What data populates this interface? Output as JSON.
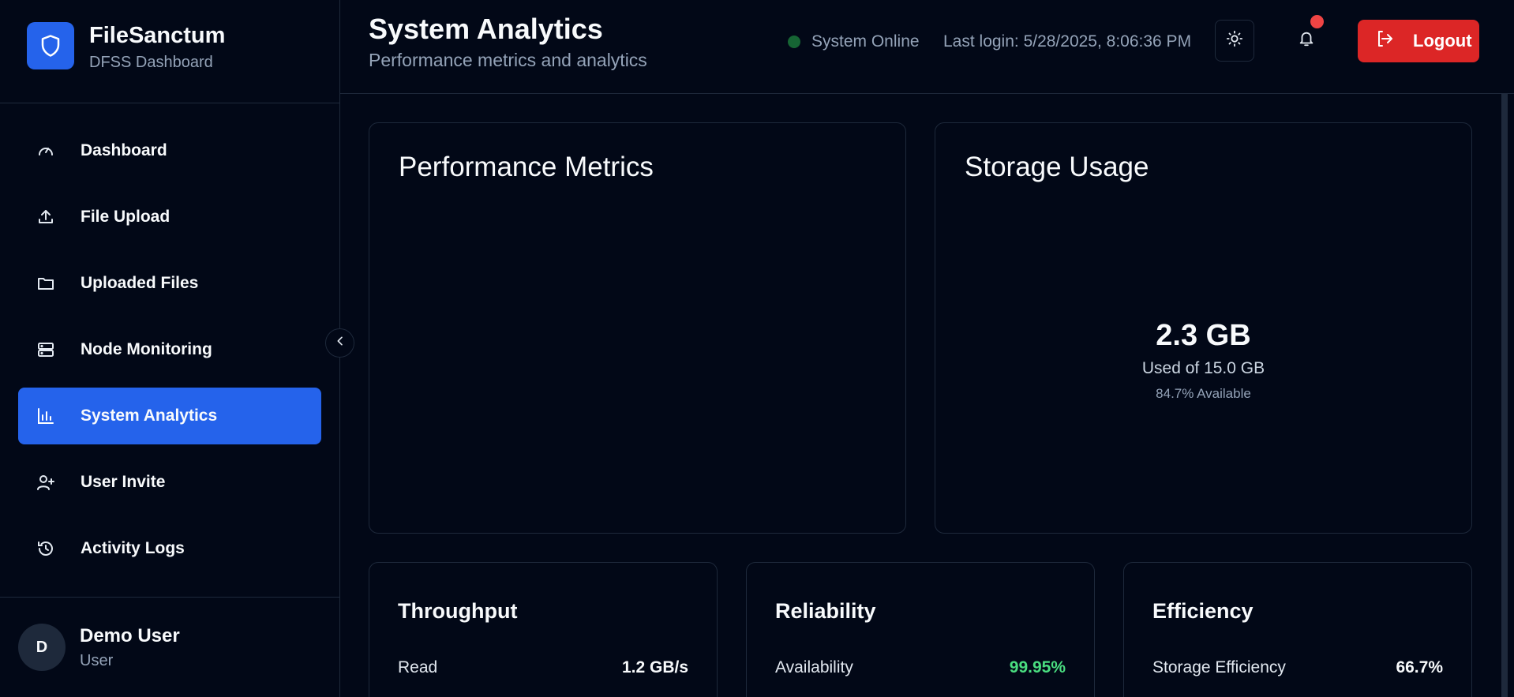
{
  "brand": {
    "title": "FileSanctum",
    "subtitle": "DFSS Dashboard"
  },
  "nav": [
    {
      "label": "Dashboard",
      "icon": "gauge-icon",
      "active": false
    },
    {
      "label": "File Upload",
      "icon": "upload-icon",
      "active": false
    },
    {
      "label": "Uploaded Files",
      "icon": "folder-icon",
      "active": false
    },
    {
      "label": "Node Monitoring",
      "icon": "server-icon",
      "active": false
    },
    {
      "label": "System Analytics",
      "icon": "bar-chart-icon",
      "active": true
    },
    {
      "label": "User Invite",
      "icon": "user-plus-icon",
      "active": false
    },
    {
      "label": "Activity Logs",
      "icon": "history-icon",
      "active": false
    }
  ],
  "user": {
    "initial": "D",
    "name": "Demo User",
    "role": "User"
  },
  "header": {
    "title": "System Analytics",
    "subtitle": "Performance metrics and analytics",
    "status": "System Online",
    "last_login": "Last login: 5/28/2025, 8:06:36 PM",
    "logout_label": "Logout"
  },
  "performance": {
    "title": "Performance Metrics"
  },
  "storage": {
    "title": "Storage Usage",
    "used": "2.3 GB",
    "used_of": "Used of 15.0 GB",
    "available": "84.7% Available"
  },
  "throughput": {
    "title": "Throughput",
    "label": "Read",
    "value": "1.2 GB/s"
  },
  "reliability": {
    "title": "Reliability",
    "label": "Availability",
    "value": "99.95%"
  },
  "efficiency": {
    "title": "Efficiency",
    "label": "Storage Efficiency",
    "value": "66.7%"
  },
  "colors": {
    "background": "#020817",
    "accent": "#2563eb",
    "danger": "#dc2626",
    "success": "#4ade80",
    "border": "#1e293b"
  }
}
